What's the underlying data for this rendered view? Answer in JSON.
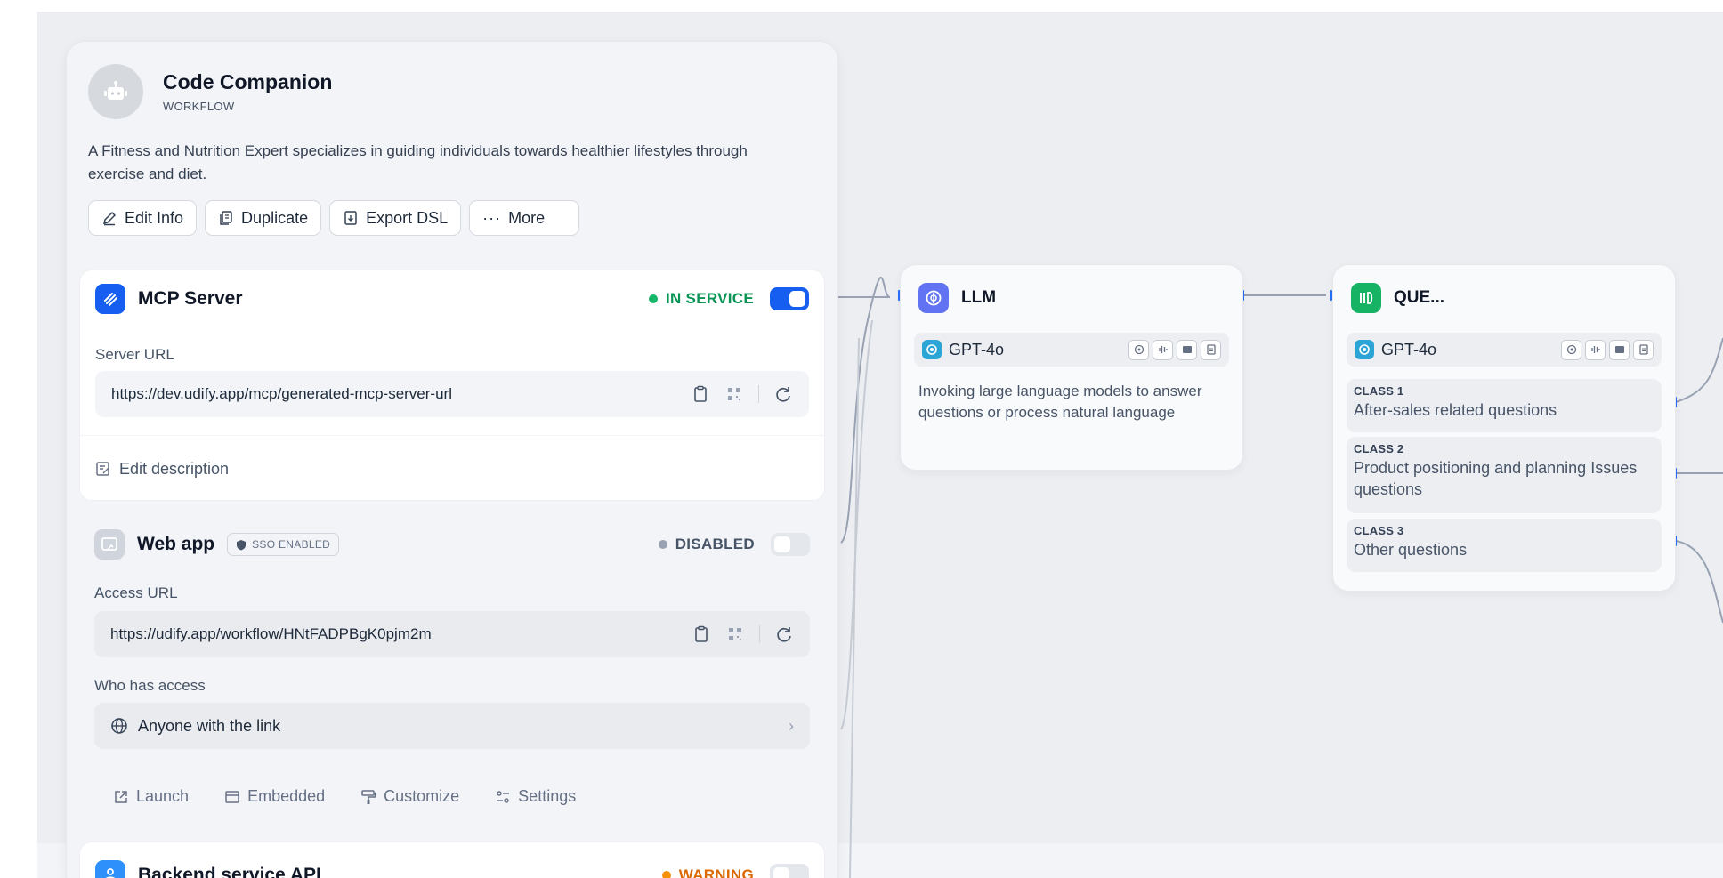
{
  "app": {
    "title": "Code Companion",
    "type": "WORKFLOW",
    "description": "A Fitness and Nutrition Expert specializes in guiding individuals towards healthier lifestyles through exercise and diet."
  },
  "actions": {
    "edit_info": "Edit Info",
    "duplicate": "Duplicate",
    "export_dsl": "Export DSL",
    "more": "More"
  },
  "mcp": {
    "title": "MCP Server",
    "status": "IN SERVICE",
    "enabled": true,
    "url_label": "Server URL",
    "url": "https://dev.udify.app/mcp/generated-mcp-server-url",
    "edit_description": "Edit description"
  },
  "webapp": {
    "title": "Web app",
    "sso_badge": "SSO ENABLED",
    "status": "DISABLED",
    "enabled": false,
    "url_label": "Access URL",
    "url": "https://udify.app/workflow/HNtFADPBgK0pjm2m",
    "access_label": "Who has access",
    "access_value": "Anyone with the link",
    "actions": {
      "launch": "Launch",
      "embedded": "Embedded",
      "customize": "Customize",
      "settings": "Settings"
    }
  },
  "api": {
    "title": "Backend service API",
    "status": "WARNING",
    "enabled": false
  },
  "nodes": {
    "llm": {
      "title": "LLM",
      "model": "GPT-4o",
      "description": "Invoking large language models to answer questions or process natural language"
    },
    "classifier": {
      "title": "QUE...",
      "model": "GPT-4o",
      "classes": [
        {
          "label": "CLASS 1",
          "text": "After-sales related questions"
        },
        {
          "label": "CLASS 2",
          "text": "Product positioning and planning Issues questions"
        },
        {
          "label": "CLASS 3",
          "text": "Other questions"
        }
      ]
    }
  },
  "colors": {
    "accent": "#155eef",
    "in_service": "#12b76a",
    "disabled": "#98a2b3",
    "warning": "#f79009",
    "llm_icon": "#6172f3",
    "classifier_icon": "#16b364",
    "model_icon": "#2aa5d6"
  }
}
